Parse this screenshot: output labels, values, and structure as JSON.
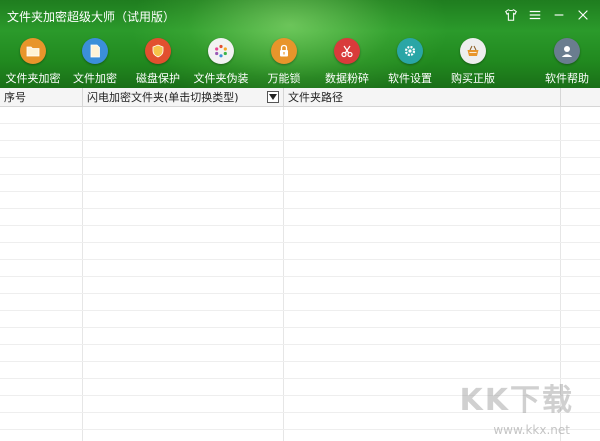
{
  "window": {
    "title": "文件夹加密超级大师（试用版）"
  },
  "toolbar": {
    "items": [
      {
        "label": "文件夹加密",
        "icon": "folder-icon",
        "color": "#e8952b"
      },
      {
        "label": "文件加密",
        "icon": "file-icon",
        "color": "#3b8fd9"
      },
      {
        "label": "磁盘保护",
        "icon": "shield-icon",
        "color": "#e2502f"
      },
      {
        "label": "文件夹伪装",
        "icon": "disguise-icon",
        "color": "#f2f2f2"
      },
      {
        "label": "万能锁",
        "icon": "lock-icon",
        "color": "#e8952b"
      },
      {
        "label": "数据粉碎",
        "icon": "scissors-icon",
        "color": "#d93b3b"
      },
      {
        "label": "软件设置",
        "icon": "gear-icon",
        "color": "#2aa6a6"
      },
      {
        "label": "购买正版",
        "icon": "basket-icon",
        "color": "#eeeeee"
      },
      {
        "label": "软件帮助",
        "icon": "user-help-icon",
        "color": "#6a7d8f"
      }
    ]
  },
  "table": {
    "columns": [
      {
        "label": "序号"
      },
      {
        "label": "闪电加密文件夹(单击切换类型)"
      },
      {
        "label": "文件夹路径"
      }
    ],
    "rows": []
  },
  "watermark": {
    "text": "KK下载",
    "url": "www.kkx.net"
  }
}
